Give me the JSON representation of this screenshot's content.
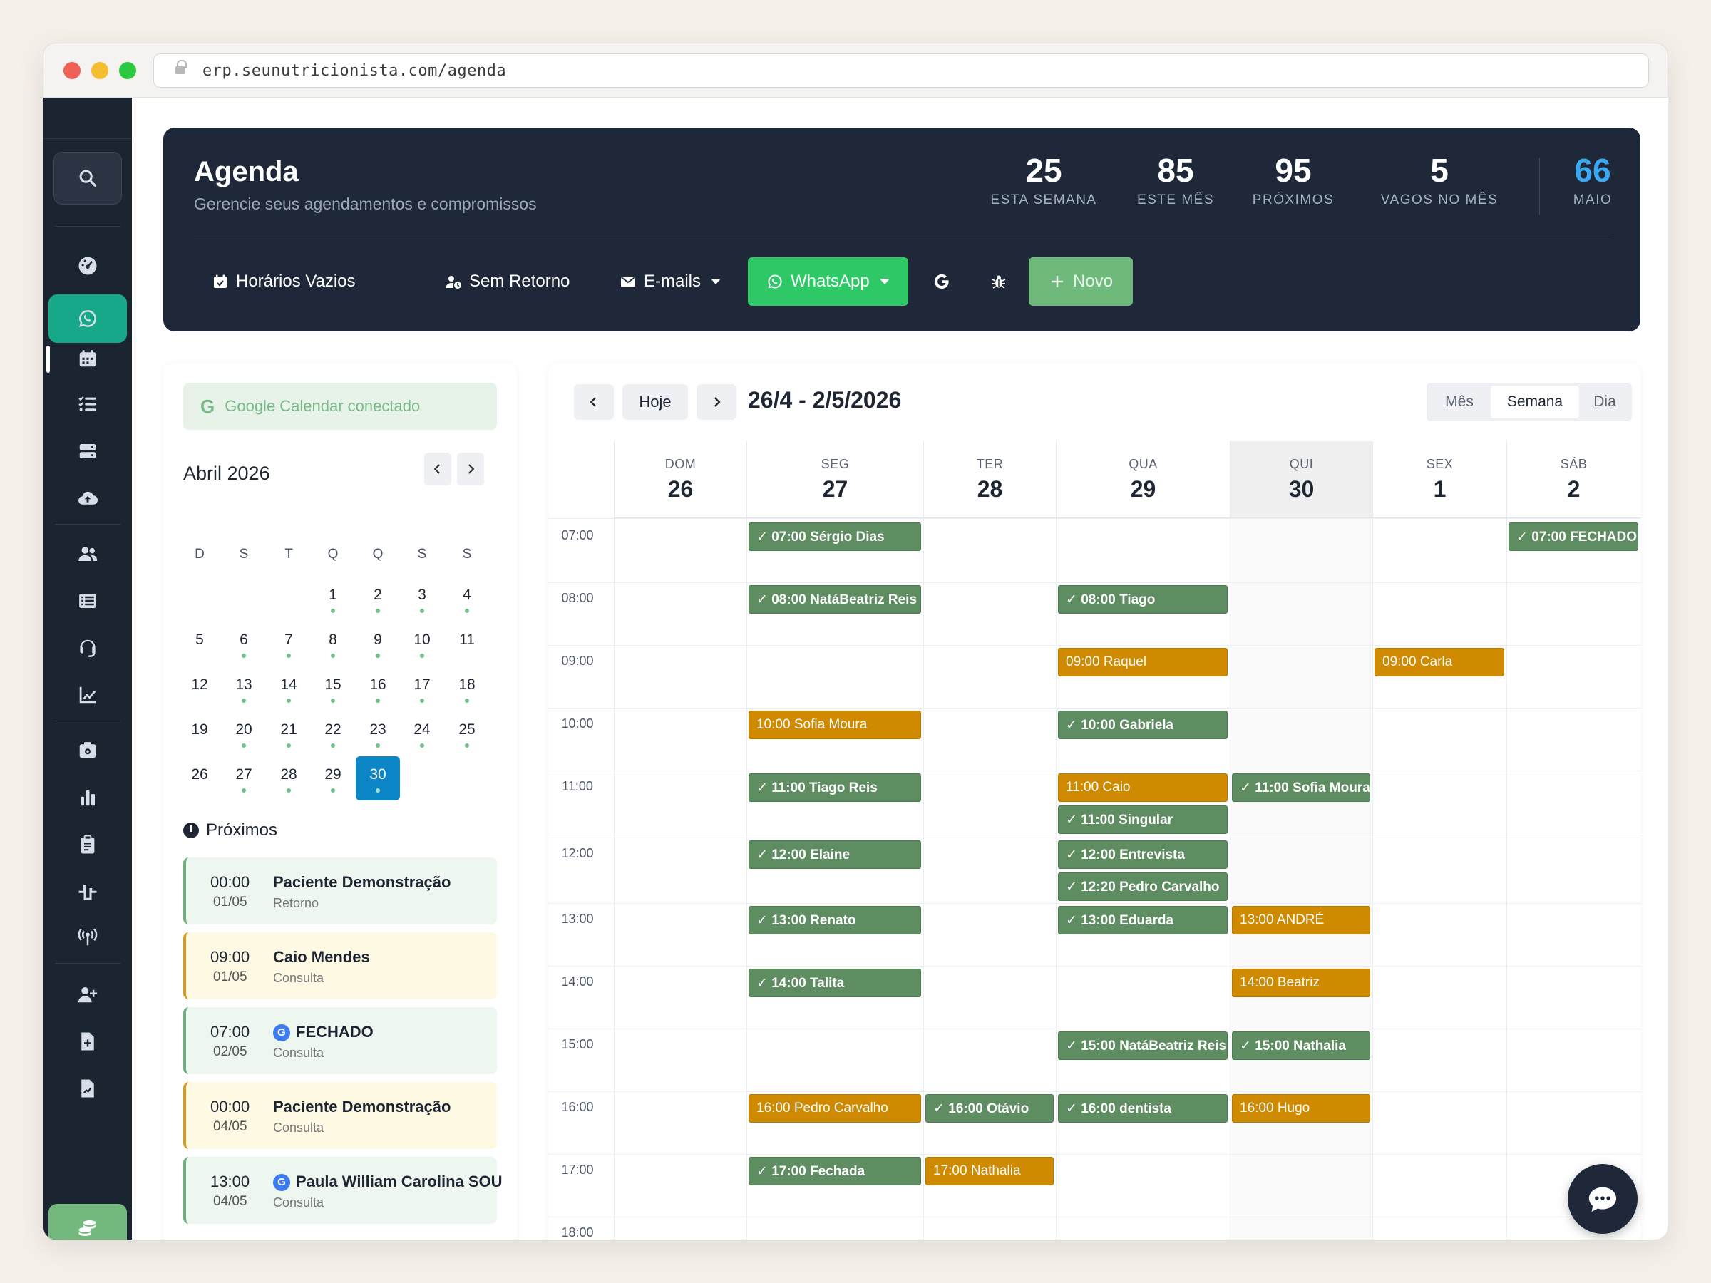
{
  "browser": {
    "url": "erp.seunutricionista.com/agenda"
  },
  "header": {
    "title": "Agenda",
    "subtitle": "Gerencie seus agendamentos e compromissos",
    "stats": [
      {
        "value": "25",
        "label": "ESTA SEMANA"
      },
      {
        "value": "85",
        "label": "ESTE MÊS"
      },
      {
        "value": "95",
        "label": "PRÓXIMOS"
      },
      {
        "value": "5",
        "label": "VAGOS NO MÊS"
      },
      {
        "value": "66",
        "label": "MAIO"
      }
    ],
    "toolbar": {
      "horarios_vazios": "Horários Vazios",
      "sem_retorno": "Sem Retorno",
      "emails": "E-mails",
      "whatsapp": "WhatsApp",
      "novo": "Novo"
    }
  },
  "colors": {
    "sidebar": "#1b2431",
    "header": "#1e2838",
    "accent_green": "#16a889",
    "confirmed": "#5e8d62",
    "pending": "#cf8a00",
    "today": "#0d86c8",
    "stat_blue": "#3aa9f3"
  },
  "left": {
    "google": "Google Calendar conectado",
    "month_title": "Abril 2026",
    "weekdays": [
      "D",
      "S",
      "T",
      "Q",
      "Q",
      "S",
      "S"
    ],
    "weeks": [
      [
        "",
        "",
        "",
        "1",
        "2",
        "3",
        "4"
      ],
      [
        "5",
        "6",
        "7",
        "8",
        "9",
        "10",
        "11"
      ],
      [
        "12",
        "13",
        "14",
        "15",
        "16",
        "17",
        "18"
      ],
      [
        "19",
        "20",
        "21",
        "22",
        "23",
        "24",
        "25"
      ],
      [
        "26",
        "27",
        "28",
        "29",
        "30",
        "",
        ""
      ]
    ],
    "selected_day": "30",
    "proximos_title": "Próximos",
    "proximos": [
      {
        "time": "00:00",
        "date": "01/05",
        "name": "Paciente Demonstração",
        "type": "Retorno",
        "google": false,
        "tone": "green"
      },
      {
        "time": "09:00",
        "date": "01/05",
        "name": "Caio Mendes",
        "type": "Consulta",
        "google": false,
        "tone": "yellow"
      },
      {
        "time": "07:00",
        "date": "02/05",
        "name": "FECHADO",
        "type": "Consulta",
        "google": true,
        "tone": "green"
      },
      {
        "time": "00:00",
        "date": "04/05",
        "name": "Paciente Demonstração",
        "type": "Consulta",
        "google": false,
        "tone": "yellow"
      },
      {
        "time": "13:00",
        "date": "04/05",
        "name": "Paula William Carolina SOU",
        "type": "Consulta",
        "google": true,
        "tone": "green"
      }
    ]
  },
  "calendar": {
    "today_btn": "Hoje",
    "range": "26/4 - 2/5/2026",
    "views": [
      "Mês",
      "Semana",
      "Dia"
    ],
    "active_view": "Semana",
    "days": [
      {
        "name": "DOM",
        "num": "26"
      },
      {
        "name": "SEG",
        "num": "27"
      },
      {
        "name": "TER",
        "num": "28"
      },
      {
        "name": "QUA",
        "num": "29"
      },
      {
        "name": "QUI",
        "num": "30",
        "today": true
      },
      {
        "name": "SEX",
        "num": "1"
      },
      {
        "name": "SÁB",
        "num": "2"
      }
    ],
    "hours": [
      "07:00",
      "08:00",
      "09:00",
      "10:00",
      "11:00",
      "12:00",
      "13:00",
      "14:00",
      "15:00",
      "16:00",
      "17:00",
      "18:00"
    ],
    "events": [
      {
        "day": 1,
        "hour": "07:00",
        "text": "✓ 07:00 Sérgio Dias",
        "status": "ok"
      },
      {
        "day": 6,
        "hour": "07:00",
        "text": "✓ 07:00 FECHADO",
        "status": "ok"
      },
      {
        "day": 1,
        "hour": "08:00",
        "text": "✓ 08:00 NatáBeatriz Reis",
        "status": "ok"
      },
      {
        "day": 3,
        "hour": "08:00",
        "text": "✓ 08:00 Tiago",
        "status": "ok"
      },
      {
        "day": 3,
        "hour": "09:00",
        "text": "09:00 Raquel",
        "status": "pend"
      },
      {
        "day": 5,
        "hour": "09:00",
        "text": "09:00 Carla",
        "status": "pend"
      },
      {
        "day": 1,
        "hour": "10:00",
        "text": "10:00 Sofia Moura",
        "status": "pend"
      },
      {
        "day": 3,
        "hour": "10:00",
        "text": "✓ 10:00 Gabriela",
        "status": "ok"
      },
      {
        "day": 1,
        "hour": "11:00",
        "text": "✓ 11:00 Tiago Reis",
        "status": "ok"
      },
      {
        "day": 3,
        "hour": "11:00",
        "text": "11:00 Caio",
        "status": "pend"
      },
      {
        "day": 3,
        "hour": "11:00",
        "stack": 1,
        "text": "✓ 11:00 Singular",
        "status": "ok"
      },
      {
        "day": 4,
        "hour": "11:00",
        "text": "✓ 11:00 Sofia Moura",
        "status": "ok"
      },
      {
        "day": 1,
        "hour": "12:00",
        "text": "✓ 12:00 Elaine",
        "status": "ok"
      },
      {
        "day": 3,
        "hour": "12:00",
        "text": "✓ 12:00 Entrevista",
        "status": "ok"
      },
      {
        "day": 3,
        "hour": "12:00",
        "stack": 1,
        "text": "✓ 12:20 Pedro Carvalho",
        "status": "ok"
      },
      {
        "day": 1,
        "hour": "13:00",
        "text": "✓ 13:00 Renato",
        "status": "ok"
      },
      {
        "day": 3,
        "hour": "13:00",
        "text": "✓ 13:00 Eduarda",
        "status": "ok"
      },
      {
        "day": 4,
        "hour": "13:00",
        "text": "13:00 ANDRÉ",
        "status": "pend"
      },
      {
        "day": 1,
        "hour": "14:00",
        "text": "✓ 14:00 Talita",
        "status": "ok"
      },
      {
        "day": 4,
        "hour": "14:00",
        "text": "14:00 Beatriz",
        "status": "pend"
      },
      {
        "day": 3,
        "hour": "15:00",
        "text": "✓ 15:00 NatáBeatriz Reis",
        "status": "ok"
      },
      {
        "day": 4,
        "hour": "15:00",
        "text": "✓ 15:00 Nathalia",
        "status": "ok"
      },
      {
        "day": 1,
        "hour": "16:00",
        "text": "16:00 Pedro Carvalho",
        "status": "pend"
      },
      {
        "day": 2,
        "hour": "16:00",
        "text": "✓ 16:00 Otávio",
        "status": "ok"
      },
      {
        "day": 3,
        "hour": "16:00",
        "text": "✓ 16:00 dentista",
        "status": "ok"
      },
      {
        "day": 4,
        "hour": "16:00",
        "text": "16:00 Hugo",
        "status": "pend"
      },
      {
        "day": 1,
        "hour": "17:00",
        "text": "✓ 17:00 Fechada",
        "status": "ok"
      },
      {
        "day": 2,
        "hour": "17:00",
        "text": "17:00 Nathalia",
        "status": "pend"
      }
    ]
  },
  "icons": [
    "search-icon",
    "dashboard-icon",
    "whatsapp-icon",
    "calendar-icon",
    "tasks-icon",
    "server-icon",
    "cloud-upload-icon",
    "users-icon",
    "list-icon",
    "headset-icon",
    "chart-line-icon",
    "cash-register-icon",
    "bar-chart-icon",
    "clipboard-icon",
    "pulse-icon",
    "broadcast-icon",
    "user-plus-icon",
    "file-plus-icon",
    "file-chart-icon",
    "coins-icon",
    "chat-icon"
  ]
}
